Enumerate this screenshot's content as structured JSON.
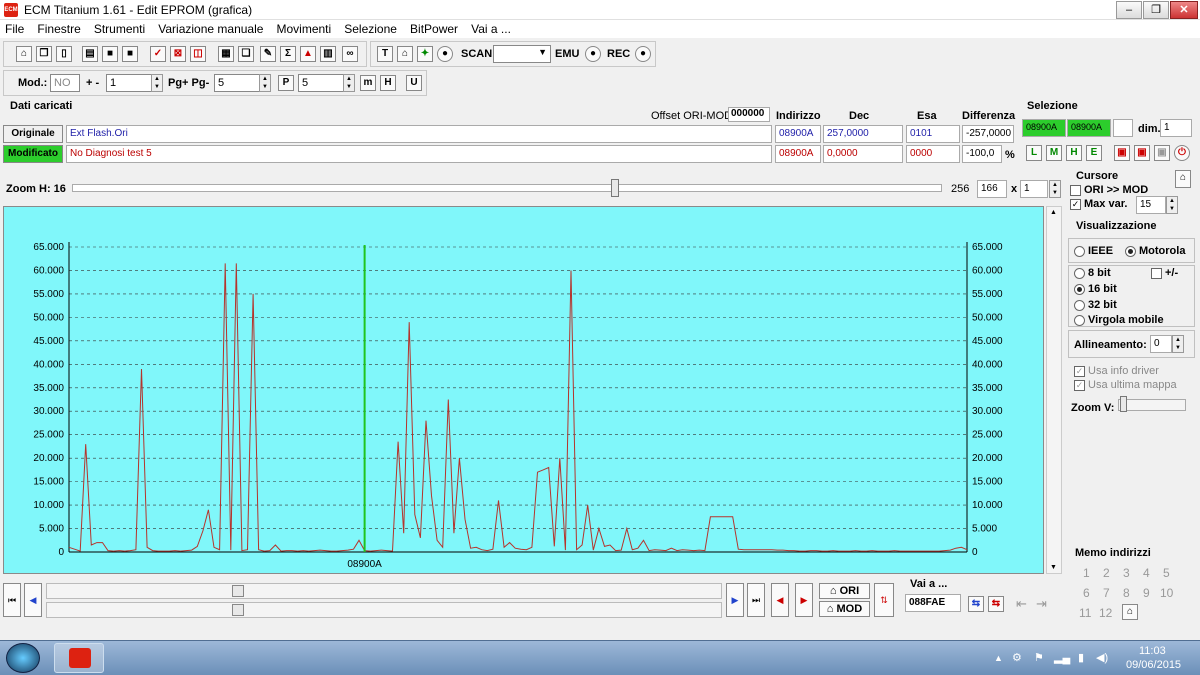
{
  "window": {
    "title": "ECM Titanium 1.61 - Edit EPROM (grafica)",
    "app_icon": "ECM",
    "btn_min": "–",
    "btn_max": "❐",
    "btn_close": "✕"
  },
  "menu": [
    "File",
    "Finestre",
    "Strumenti",
    "Variazione manuale",
    "Movimenti",
    "Selezione",
    "BitPower",
    "Vai a ..."
  ],
  "toolbar": {
    "scan_label": "SCAN",
    "emu_label": "EMU",
    "rec_label": "REC",
    "mod_label": "Mod.:",
    "mod_value": "NO",
    "plusminus_label": "+ -",
    "plusminus_value": "1",
    "pg_label": "Pg+ Pg-",
    "pg_value": "5",
    "p_value": "5"
  },
  "dati": {
    "header": "Dati caricati",
    "offset_label": "Offset ORI-MOD",
    "offset_value": "000000",
    "col_indirizzo": "Indirizzo",
    "col_dec": "Dec",
    "col_esa": "Esa",
    "col_diff": "Differenza",
    "originale": {
      "label": "Originale",
      "file": "Ext Flash.Ori",
      "indirizzo": "08900A",
      "dec": "257,0000",
      "esa": "0101",
      "diff": "-257,0000"
    },
    "modificato": {
      "label": "Modificato",
      "file": "No Diagnosi test 5",
      "indirizzo": "08900A",
      "dec": "0,0000",
      "esa": "0000",
      "diff": "-100,0",
      "unit": "%"
    }
  },
  "selezione": {
    "header": "Selezione",
    "from": "08900A",
    "to": "08900A",
    "dim_label": "dim.",
    "dim_value": "1"
  },
  "zoom": {
    "label": "Zoom H: 16",
    "value_max": "256",
    "value_cur": "166",
    "times": "x",
    "mult": "1"
  },
  "cursore": {
    "header": "Cursore",
    "ori_mod": "ORI >> MOD",
    "max_var": "Max var.",
    "max_var_value": "15"
  },
  "visualizzazione": {
    "header": "Visualizzazione",
    "ieee": "IEEE",
    "motorola": "Motorola",
    "bit8": "8 bit",
    "plusminus": "+/-",
    "bit16": "16 bit",
    "bit32": "32 bit",
    "virgola": "Virgola mobile",
    "allineamento": "Allineamento:",
    "allineamento_value": "0",
    "usa_info": "Usa info driver",
    "usa_ultima": "Usa ultima mappa",
    "zoom_v": "Zoom V:"
  },
  "chart_data": {
    "type": "line",
    "x_label_marker": "08900A",
    "ylim": [
      0,
      65000
    ],
    "yticks": [
      "0",
      "5.000",
      "10.000",
      "15.000",
      "20.000",
      "25.000",
      "30.000",
      "35.000",
      "40.000",
      "45.000",
      "50.000",
      "55.000",
      "60.000",
      "65.000"
    ],
    "grid": true,
    "cursor_index": 53,
    "series": [
      {
        "color": "#b5342c",
        "values": [
          1000,
          600,
          200,
          23000,
          1500,
          2000,
          2000,
          300,
          200,
          300,
          200,
          300,
          500,
          39000,
          1000,
          300,
          200,
          200,
          200,
          300,
          200,
          300,
          400,
          1200,
          4500,
          9000,
          1000,
          500,
          61500,
          400,
          61500,
          300,
          500,
          55000,
          500,
          200,
          300,
          1500,
          200,
          300,
          300,
          200,
          300,
          200,
          300,
          400,
          300,
          200,
          200,
          300,
          400,
          600,
          2500,
          300,
          200,
          300,
          400,
          300,
          200,
          23500,
          4000,
          49000,
          8000,
          3000,
          28000,
          12000,
          2500,
          1000,
          32500,
          4000,
          20000,
          7000,
          800,
          1000,
          500,
          300,
          600,
          11000,
          1000,
          2000,
          800,
          600,
          500,
          1000,
          17000,
          17500,
          18000,
          1200,
          20000,
          400,
          60000,
          500,
          1500,
          10000,
          400,
          5000,
          1200,
          1500,
          300,
          400,
          5000,
          500,
          800,
          2500,
          300,
          500,
          400,
          300,
          800,
          300,
          500,
          400,
          300,
          400,
          300,
          7500,
          7500,
          7500,
          7500,
          7500,
          600,
          500,
          500,
          500,
          500,
          500,
          500,
          400,
          400,
          300,
          300,
          200,
          200,
          300,
          300,
          200,
          200,
          300,
          200,
          200,
          200,
          300,
          200,
          200,
          300,
          200,
          200,
          200,
          300,
          200,
          200,
          200,
          200,
          200,
          200,
          200,
          200,
          300,
          400,
          800,
          1000,
          500
        ]
      }
    ]
  },
  "bottom": {
    "ori_btn": "ORI",
    "mod_btn": "MOD",
    "vai_label": "Vai a ...",
    "vai_value": "088FAE",
    "memo_header": "Memo indirizzi",
    "memo": [
      "1",
      "2",
      "3",
      "4",
      "5",
      "6",
      "7",
      "8",
      "9",
      "10",
      "11",
      "12"
    ]
  },
  "taskbar": {
    "time": "11:03",
    "date": "09/06/2015"
  }
}
